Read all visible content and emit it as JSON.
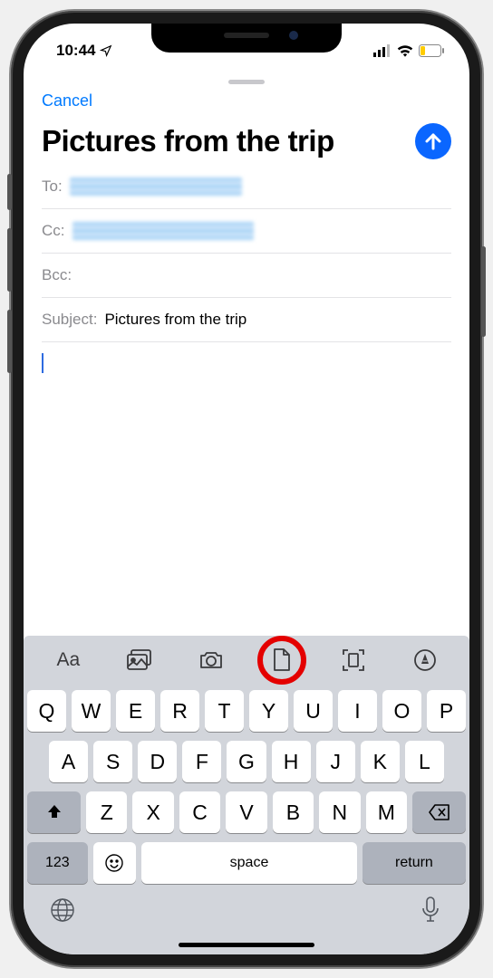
{
  "status": {
    "time": "10:44"
  },
  "nav": {
    "cancel_label": "Cancel"
  },
  "compose": {
    "title": "Pictures from the trip",
    "to_label": "To:",
    "cc_label": "Cc:",
    "bcc_label": "Bcc:",
    "subject_label": "Subject:",
    "subject_value": "Pictures from the trip"
  },
  "format_bar": {
    "text_style": "Aa"
  },
  "keyboard": {
    "row1": [
      "Q",
      "W",
      "E",
      "R",
      "T",
      "Y",
      "U",
      "I",
      "O",
      "P"
    ],
    "row2": [
      "A",
      "S",
      "D",
      "F",
      "G",
      "H",
      "J",
      "K",
      "L"
    ],
    "row3": [
      "Z",
      "X",
      "C",
      "V",
      "B",
      "N",
      "M"
    ],
    "num_label": "123",
    "space_label": "space",
    "return_label": "return"
  }
}
